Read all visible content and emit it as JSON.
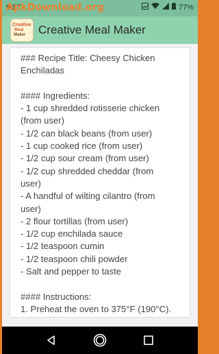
{
  "status_bar": {
    "time": "9:57",
    "watermark": "ApkDownload.org",
    "battery": "77%"
  },
  "app_bar": {
    "title": "Creative Meal Maker",
    "logo_text": {
      "line1": "Creative",
      "line2": "Meal",
      "line3": "Maker"
    }
  },
  "recipe": {
    "lines": [
      "### Recipe Title: Cheesy Chicken",
      "Enchiladas",
      "",
      "#### Ingredients:",
      "- 1 cup shredded rotisserie chicken",
      "(from user)",
      "- 1/2 can black beans (from user)",
      "- 1 cup cooked rice (from user)",
      "- 1/2 cup sour cream (from user)",
      "- 1/2 cup shredded cheddar (from",
      "user)",
      "- A handful of wilting cilantro (from",
      "user)",
      "- 2 flour tortillas (from user)",
      "- 1/2 cup enchilada sauce",
      "- 1/2 teaspoon cumin",
      "- 1/2 teaspoon chili powder",
      "- Salt and pepper to taste",
      "",
      "#### Instructions:",
      "1. Preheat the oven to 375°F (190°C)."
    ]
  },
  "colors": {
    "status_bar": "#7dbf9c",
    "app_bar": "#8fd3ae",
    "watermark": "#e9812c",
    "border": "#e6812a"
  },
  "icons": {
    "status": [
      "image-icon",
      "photo-icon",
      "settings-icon",
      "wifi-icon",
      "signal-icon",
      "battery-icon"
    ],
    "nav": [
      "back-icon",
      "home-icon",
      "recents-icon"
    ]
  }
}
